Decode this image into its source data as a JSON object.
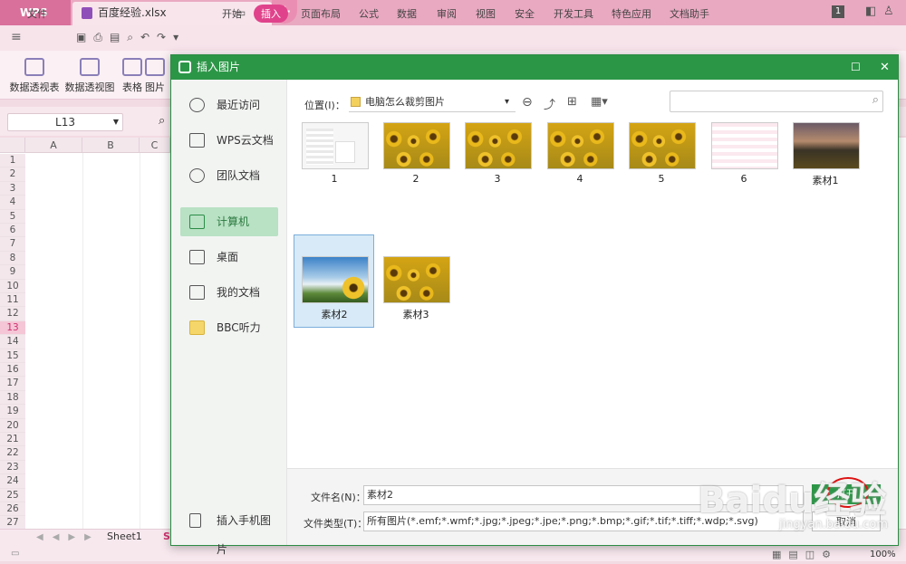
{
  "app": {
    "name": "WPS",
    "file_tab": "百度经验.xlsx",
    "tab_count": "1"
  },
  "menu": [
    "文件",
    "开始",
    "插入",
    "页面布局",
    "公式",
    "数据",
    "审阅",
    "视图",
    "安全",
    "开发工具",
    "特色应用",
    "文档助手"
  ],
  "menu_active": "插入",
  "ribbon": [
    "数据透视表",
    "数据透视图",
    "表格",
    "图片"
  ],
  "namebox": "L13",
  "columns": [
    "A",
    "B",
    "C"
  ],
  "rows": [
    "1",
    "2",
    "3",
    "4",
    "5",
    "6",
    "7",
    "8",
    "9",
    "10",
    "11",
    "12",
    "13",
    "14",
    "15",
    "16",
    "17",
    "18",
    "19",
    "20",
    "21",
    "22",
    "23",
    "24",
    "25",
    "26",
    "27"
  ],
  "selected_row": "13",
  "sheet_tabs": [
    "Sheet1",
    "Sl"
  ],
  "zoom": "100%",
  "dialog": {
    "title": "插入图片",
    "side": [
      "最近访问",
      "WPS云文档",
      "团队文档",
      "计算机",
      "桌面",
      "我的文档",
      "BBC听力"
    ],
    "side_selected": "计算机",
    "mobile": "插入手机图片",
    "location_label": "位置(I)：",
    "location_value": "电脑怎么裁剪图片",
    "files": [
      "1",
      "2",
      "3",
      "4",
      "5",
      "6",
      "素材1",
      "素材2",
      "素材3"
    ],
    "selected_file": "素材2",
    "filename_label": "文件名(N)：",
    "filename_value": "素材2",
    "filetype_label": "文件类型(T)：",
    "filetype_value": "所有图片(*.emf;*.wmf;*.jpg;*.jpeg;*.jpe;*.png;*.bmp;*.gif;*.tif;*.tiff;*.wdp;*.svg)",
    "open_button": "打开",
    "cancel_button": "取消"
  },
  "watermark": {
    "text": "Baidu经验",
    "url": "jingyan.baidu.com"
  },
  "colors": {
    "accent": "#2c9647",
    "menu_active": "#e0438b",
    "tabbar": "#e9a9c1"
  }
}
